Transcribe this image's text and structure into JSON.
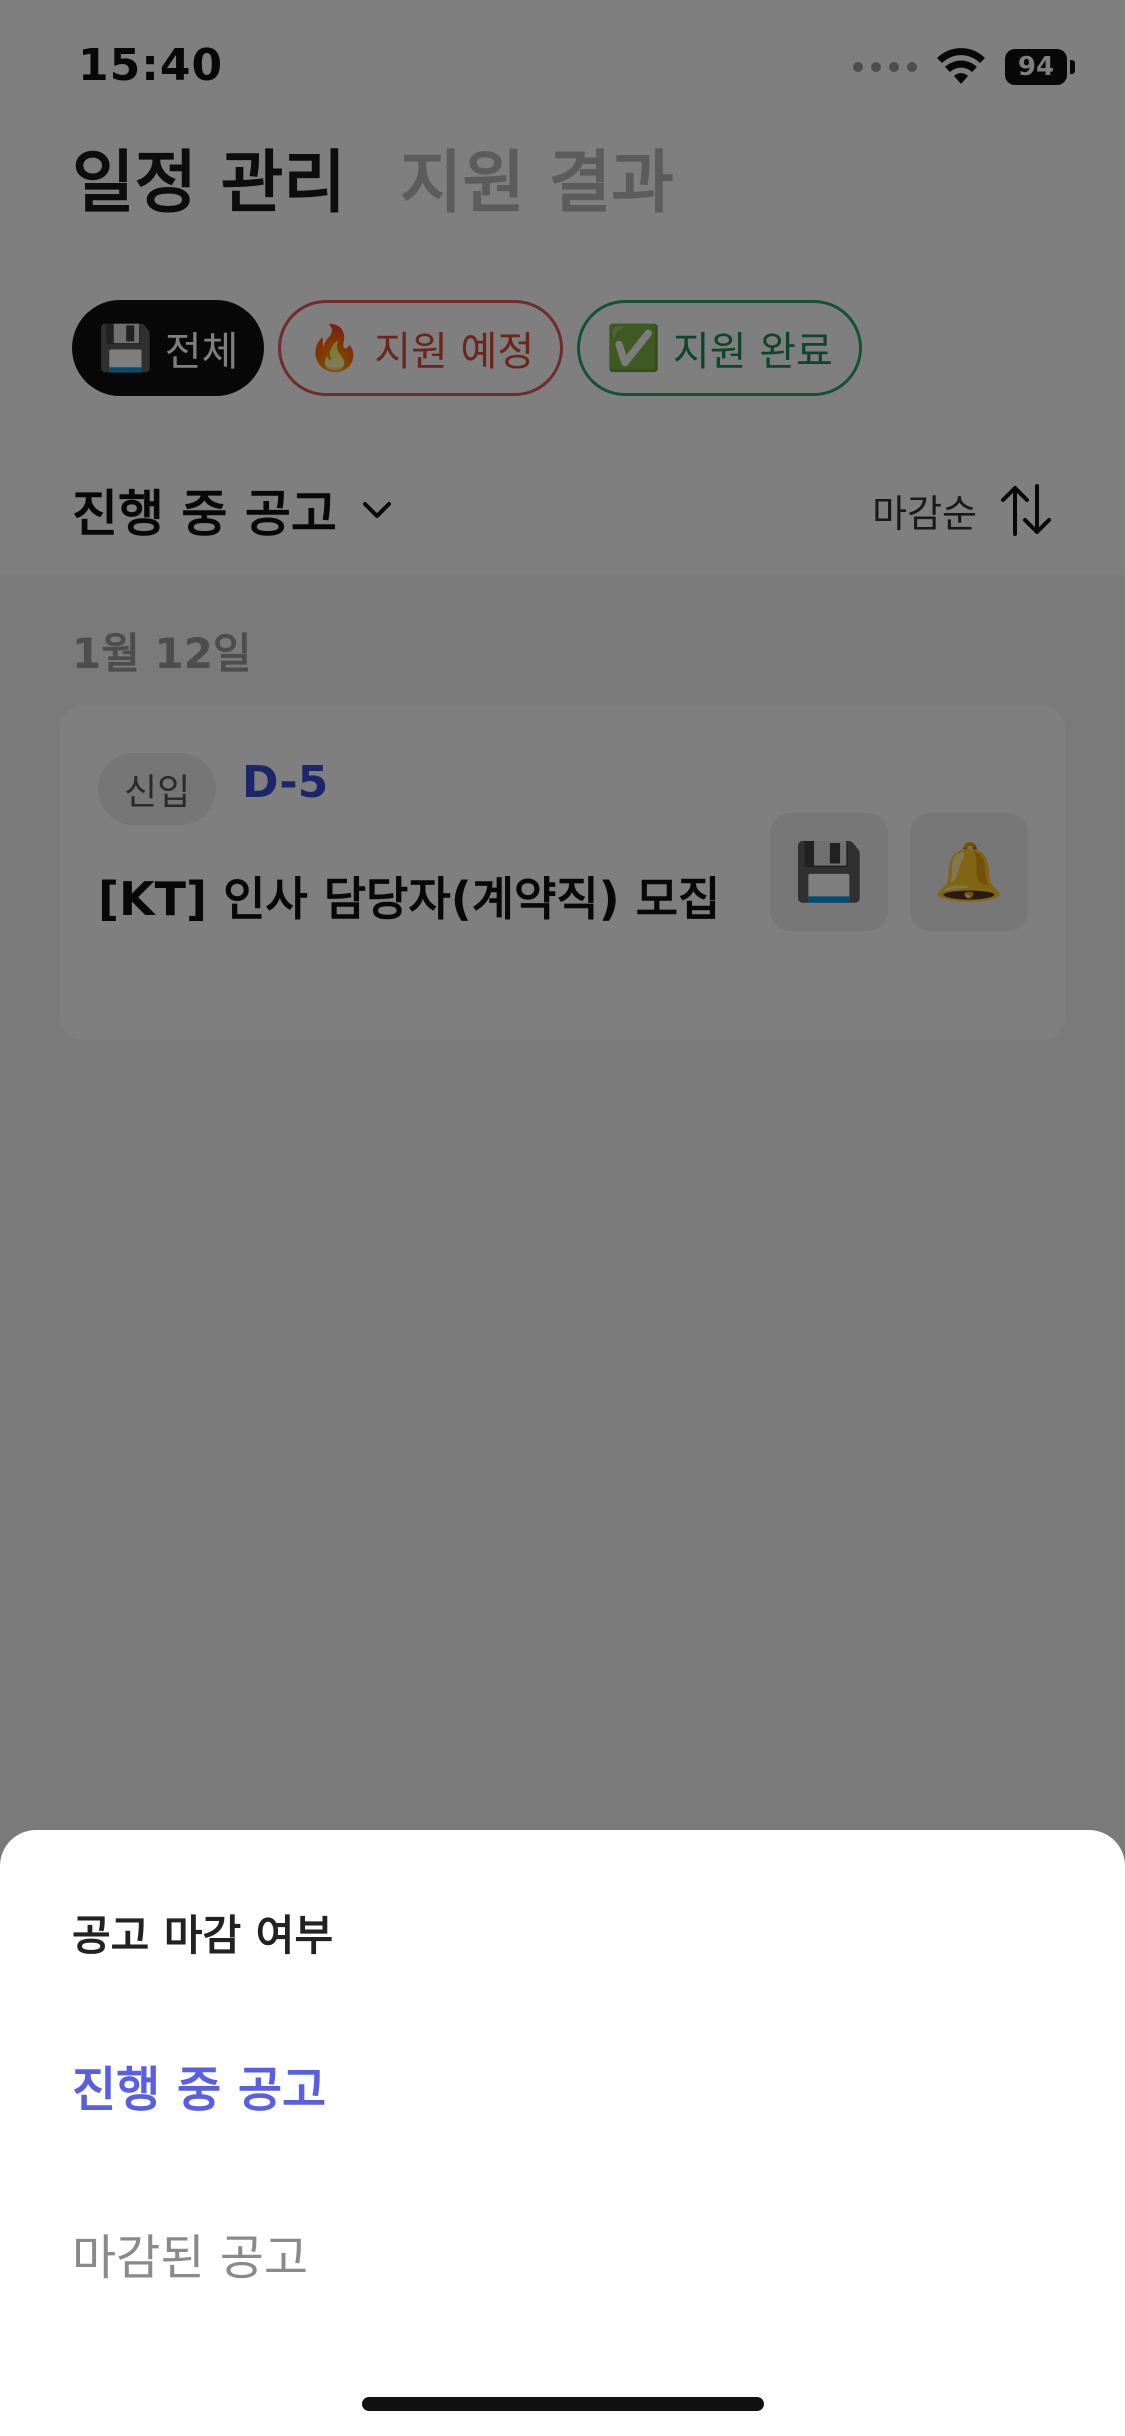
{
  "status_bar": {
    "time": "15:40",
    "battery": "94"
  },
  "header": {
    "tabs": [
      {
        "label": "일정 관리",
        "active": true
      },
      {
        "label": "지원 결과",
        "active": false
      }
    ]
  },
  "filters": [
    {
      "emoji": "💾",
      "label": "전체",
      "selected": true
    },
    {
      "emoji": "🔥",
      "label": "지원 예정",
      "selected": false
    },
    {
      "emoji": "✅",
      "label": "지원 완료",
      "selected": false
    }
  ],
  "section": {
    "title": "진행 중 공고",
    "sort_label": "마감순"
  },
  "list": {
    "date": "1월 12일",
    "items": [
      {
        "badge": "신입",
        "dday": "D-5",
        "title": "[KT] 인사 담당자(계약직) 모집",
        "save_emoji": "💾",
        "bell_emoji": "🔔"
      }
    ]
  },
  "sheet": {
    "title": "공고 마감 여부",
    "options": [
      {
        "label": "진행 중 공고",
        "selected": true
      },
      {
        "label": "마감된 공고",
        "selected": false
      }
    ]
  },
  "colors": {
    "accent": "#5a5fe0",
    "dday": "#3b4bd6",
    "planned": "#d94a3a",
    "done": "#1f8a55"
  }
}
